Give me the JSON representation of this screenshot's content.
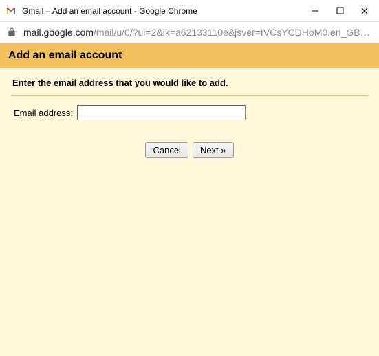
{
  "window": {
    "title": "Gmail – Add an email account - Google Chrome"
  },
  "address": {
    "host": "mail.google.com",
    "path": "/mail/u/0/?ui=2&ik=a62133110e&jsver=IVCsYCDHoM0.en_GB…"
  },
  "page": {
    "header": "Add an email account",
    "instruction": "Enter the email address that you would like to add.",
    "email_label": "Email address:",
    "email_value": "",
    "cancel_label": "Cancel",
    "next_label": "Next »"
  }
}
